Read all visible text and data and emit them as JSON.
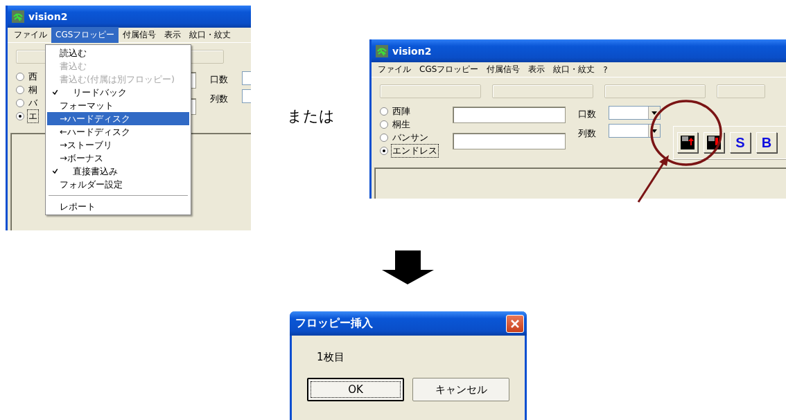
{
  "left_screenshot": {
    "window_title": "vision2",
    "menu": [
      {
        "label": "ファイル",
        "selected": false
      },
      {
        "label": "CGSフロッピー",
        "selected": true
      },
      {
        "label": "付属信号",
        "selected": false
      },
      {
        "label": "表示",
        "selected": false
      },
      {
        "label": "紋口・紋丈",
        "selected": false
      }
    ],
    "radio_options": [
      {
        "label": "西",
        "selected": false
      },
      {
        "label": "桐",
        "selected": false
      },
      {
        "label": "バ",
        "selected": false
      },
      {
        "label": "エ",
        "selected": true
      }
    ],
    "labels": [
      "口数",
      "列数"
    ],
    "dropdown_menu": [
      {
        "kind": "item",
        "label": "読込む",
        "disabled": false,
        "checked": false,
        "selected": false
      },
      {
        "kind": "item",
        "label": "書込む",
        "disabled": true,
        "checked": false,
        "selected": false
      },
      {
        "kind": "item",
        "label": "書込む(付属は別フロッピー)",
        "disabled": true,
        "checked": false,
        "selected": false
      },
      {
        "kind": "item",
        "label": "リードバック",
        "disabled": false,
        "checked": true,
        "selected": false
      },
      {
        "kind": "item",
        "label": "フォーマット",
        "disabled": false,
        "checked": false,
        "selected": false
      },
      {
        "kind": "item",
        "label": "→ハードディスク",
        "disabled": false,
        "checked": false,
        "selected": true
      },
      {
        "kind": "item",
        "label": "←ハードディスク",
        "disabled": false,
        "checked": false,
        "selected": false
      },
      {
        "kind": "item",
        "label": "→ストーブリ",
        "disabled": false,
        "checked": false,
        "selected": false
      },
      {
        "kind": "item",
        "label": "→ボーナス",
        "disabled": false,
        "checked": false,
        "selected": false
      },
      {
        "kind": "item",
        "label": "直接書込み",
        "disabled": false,
        "checked": true,
        "selected": false
      },
      {
        "kind": "item",
        "label": "フォルダー設定",
        "disabled": false,
        "checked": false,
        "selected": false
      },
      {
        "kind": "separator"
      },
      {
        "kind": "item",
        "label": "レポート",
        "disabled": false,
        "checked": false,
        "selected": false
      }
    ]
  },
  "separator_text": "または",
  "right_screenshot": {
    "window_title": "vision2",
    "menu": [
      {
        "label": "ファイル",
        "selected": false
      },
      {
        "label": "CGSフロッピー",
        "selected": false
      },
      {
        "label": "付属信号",
        "selected": false
      },
      {
        "label": "表示",
        "selected": false
      },
      {
        "label": "紋口・紋丈",
        "selected": false
      },
      {
        "label": "?",
        "selected": false
      }
    ],
    "radio_options": [
      {
        "label": "西陣",
        "selected": false
      },
      {
        "label": "桐生",
        "selected": false
      },
      {
        "label": "バンサン",
        "selected": false
      },
      {
        "label": "エンドレス",
        "selected": true
      }
    ],
    "labels": [
      "口数",
      "列数"
    ],
    "toolbar_buttons": [
      {
        "kind": "floppy-up"
      },
      {
        "kind": "floppy-down"
      },
      {
        "kind": "text",
        "label": "S"
      },
      {
        "kind": "text",
        "label": "B"
      }
    ]
  },
  "dialog": {
    "title": "フロッピー挿入",
    "message": "1枚目",
    "buttons": [
      {
        "label": "OK",
        "selected": true
      },
      {
        "label": "キャンセル",
        "selected": false
      }
    ]
  }
}
